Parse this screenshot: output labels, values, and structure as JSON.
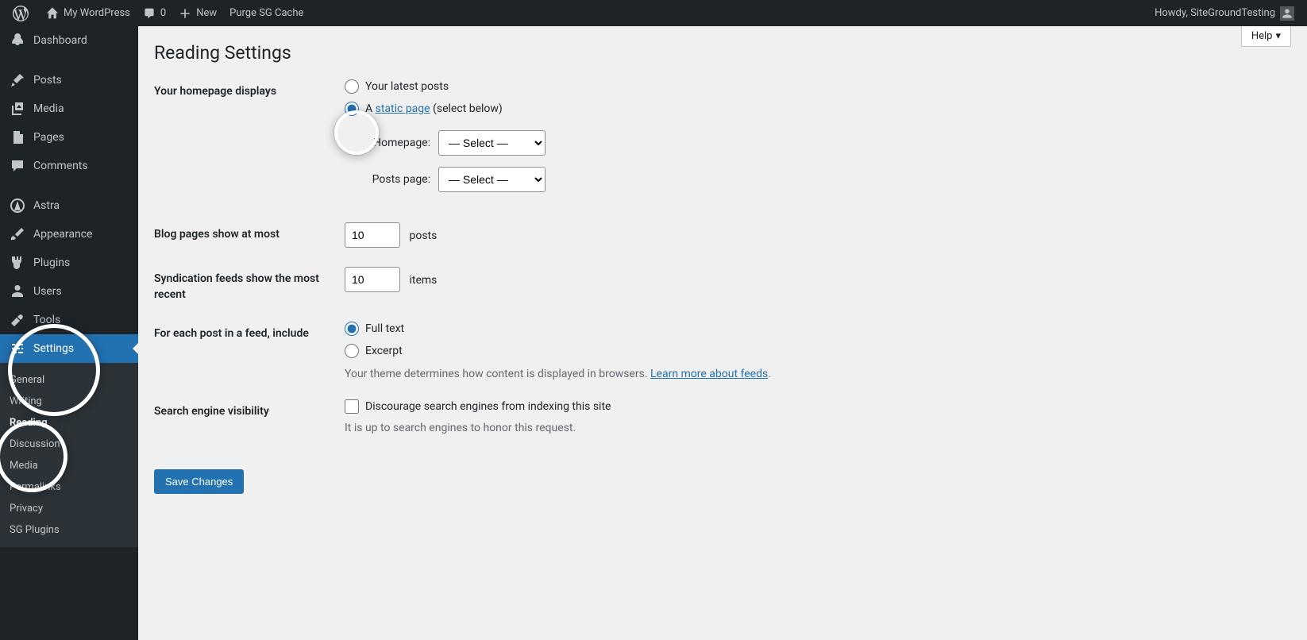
{
  "admin_bar": {
    "site_name": "My WordPress",
    "comments_count": "0",
    "new_label": "New",
    "purge_label": "Purge SG Cache",
    "howdy": "Howdy, SiteGroundTesting"
  },
  "sidebar": {
    "items": [
      {
        "label": "Dashboard",
        "icon": "dashboard"
      },
      {
        "label": "Posts",
        "icon": "pin"
      },
      {
        "label": "Media",
        "icon": "media"
      },
      {
        "label": "Pages",
        "icon": "pages"
      },
      {
        "label": "Comments",
        "icon": "comment"
      },
      {
        "label": "Astra",
        "icon": "astra"
      },
      {
        "label": "Appearance",
        "icon": "brush"
      },
      {
        "label": "Plugins",
        "icon": "plug"
      },
      {
        "label": "Users",
        "icon": "user"
      },
      {
        "label": "Tools",
        "icon": "wrench"
      },
      {
        "label": "Settings",
        "icon": "sliders",
        "active": true
      }
    ],
    "submenu": [
      {
        "label": "General"
      },
      {
        "label": "Writing"
      },
      {
        "label": "Reading",
        "current": true
      },
      {
        "label": "Discussion"
      },
      {
        "label": "Media"
      },
      {
        "label": "Permalinks"
      },
      {
        "label": "Privacy"
      },
      {
        "label": "SG Plugins"
      }
    ]
  },
  "page": {
    "title": "Reading Settings",
    "help": "Help"
  },
  "form": {
    "homepage_displays_label": "Your homepage displays",
    "latest_posts": "Your latest posts",
    "static_prefix": "A ",
    "static_link": "static page",
    "static_suffix": " (select below)",
    "homepage_label": "Homepage:",
    "posts_page_label": "Posts page:",
    "select_placeholder": "— Select —",
    "blog_pages_label": "Blog pages show at most",
    "blog_pages_value": "10",
    "posts_suffix": "posts",
    "syndication_label": "Syndication feeds show the most recent",
    "syndication_value": "10",
    "items_suffix": "items",
    "feed_include_label": "For each post in a feed, include",
    "full_text": "Full text",
    "excerpt": "Excerpt",
    "feed_desc_prefix": "Your theme determines how content is displayed in browsers. ",
    "feed_desc_link": "Learn more about feeds",
    "feed_desc_suffix": ".",
    "search_visibility_label": "Search engine visibility",
    "discourage_label": "Discourage search engines from indexing this site",
    "discourage_desc": "It is up to search engines to honor this request.",
    "save_button": "Save Changes"
  }
}
